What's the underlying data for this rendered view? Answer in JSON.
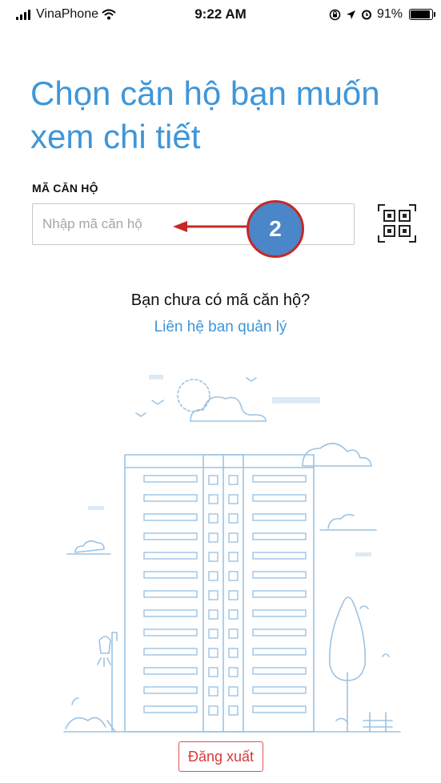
{
  "status_bar": {
    "carrier": "VinaPhone",
    "time": "9:22 AM",
    "battery": "91%"
  },
  "page": {
    "title": "Chọn căn hộ bạn muốn xem chi tiết"
  },
  "form": {
    "label": "MÃ CĂN HỘ",
    "placeholder": "Nhập mã căn hộ",
    "value": ""
  },
  "annotation": {
    "badge": "2",
    "color": "#c62828",
    "badge_fill": "#4a86c8"
  },
  "help": {
    "question": "Bạn chưa có mã căn hộ?",
    "link": "Liên hệ ban quản lý"
  },
  "footer": {
    "logout": "Đăng xuất"
  },
  "colors": {
    "accent": "#3f96d8",
    "illustration": "#9cc3e3",
    "logout": "#d33b3b"
  },
  "icons": [
    "signal-icon",
    "wifi-icon",
    "lock-rotation-icon",
    "location-icon",
    "alarm-icon",
    "battery-icon",
    "qr-scan-icon"
  ]
}
